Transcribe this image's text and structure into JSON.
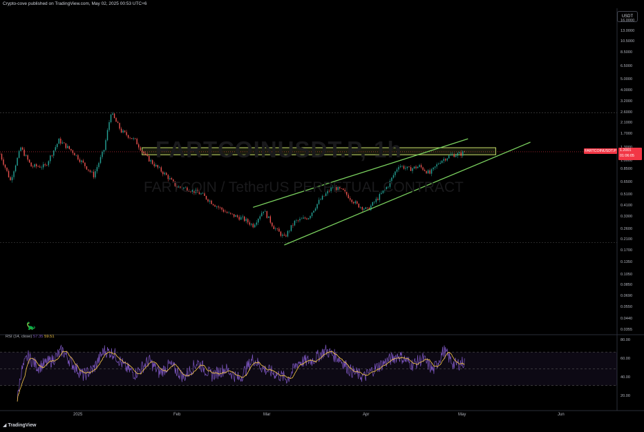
{
  "header": {
    "text": "Crypto-cove published on TradingView.com, May 02, 2025 00:53 UTC+6"
  },
  "watermark": {
    "line1": "FARTCOINUSDT.P, 1h",
    "line2": "FARTCOIN / TetherUS PERPETUAL CONTRACT"
  },
  "currency_button": "USDT",
  "price_axis": {
    "ticks": [
      "16.0000",
      "13.0000",
      "10.5000",
      "8.5000",
      "6.5000",
      "5.0000",
      "4.0000",
      "3.2000",
      "2.6000",
      "2.1000",
      "1.7000",
      "1.3000",
      "1.0000",
      "0.8500",
      "0.6500",
      "0.5100",
      "0.4100",
      "0.3300",
      "0.2600",
      "0.2100",
      "0.1700",
      "0.1350",
      "0.1050",
      "0.0850",
      "0.0690",
      "0.0550",
      "0.0440",
      "0.0355"
    ]
  },
  "last_price": {
    "symbol": "FARTCOINUSDT.P",
    "price": "1.2001",
    "countdown": "01:06:05"
  },
  "rsi": {
    "label": "RSI (14, close)",
    "value": "57.35",
    "ma_value": "59.51",
    "ticks": [
      "80.00",
      "60.00",
      "40.00",
      "20.00"
    ]
  },
  "time_axis": {
    "labels": [
      "2025",
      "Feb",
      "Mar",
      "Apr",
      "May",
      "Jun"
    ]
  },
  "footer": {
    "brand": "TradingView"
  },
  "colors": {
    "up": "#26a69a",
    "down": "#ef5350",
    "trend": "#7bd25f",
    "rsi_line": "#7e57c2",
    "rsi_ma": "#f7c948",
    "zone_border": "#c8e06a",
    "last_price": "#f23645"
  },
  "chart_data": [
    {
      "type": "candlestick",
      "title": "FARTCOINUSDT.P, 1h",
      "y_scale": "log",
      "ylim": [
        0.0355,
        16.0
      ],
      "x_range": [
        "2024-12-18",
        "2025-06-14"
      ],
      "close_path": [
        [
          "2024-12-18",
          1.15
        ],
        [
          "2024-12-21",
          0.68
        ],
        [
          "2024-12-24",
          1.3
        ],
        [
          "2024-12-27",
          0.9
        ],
        [
          "2024-12-31",
          0.9
        ],
        [
          "2025-01-04",
          1.5
        ],
        [
          "2025-01-08",
          1.2
        ],
        [
          "2025-01-11",
          0.95
        ],
        [
          "2025-01-14",
          0.75
        ],
        [
          "2025-01-17",
          1.25
        ],
        [
          "2025-01-19",
          2.6
        ],
        [
          "2025-01-22",
          1.8
        ],
        [
          "2025-01-26",
          1.5
        ],
        [
          "2025-01-29",
          1.1
        ],
        [
          "2025-02-01",
          0.9
        ],
        [
          "2025-02-04",
          0.75
        ],
        [
          "2025-02-07",
          0.6
        ],
        [
          "2025-02-10",
          0.58
        ],
        [
          "2025-02-14",
          0.52
        ],
        [
          "2025-02-18",
          0.42
        ],
        [
          "2025-02-22",
          0.35
        ],
        [
          "2025-02-26",
          0.32
        ],
        [
          "2025-03-01",
          0.28
        ],
        [
          "2025-03-04",
          0.38
        ],
        [
          "2025-03-07",
          0.27
        ],
        [
          "2025-03-10",
          0.22
        ],
        [
          "2025-03-13",
          0.3
        ],
        [
          "2025-03-17",
          0.33
        ],
        [
          "2025-03-20",
          0.45
        ],
        [
          "2025-03-24",
          0.6
        ],
        [
          "2025-03-27",
          0.55
        ],
        [
          "2025-03-31",
          0.42
        ],
        [
          "2025-04-03",
          0.38
        ],
        [
          "2025-04-06",
          0.48
        ],
        [
          "2025-04-09",
          0.62
        ],
        [
          "2025-04-12",
          0.92
        ],
        [
          "2025-04-15",
          0.85
        ],
        [
          "2025-04-18",
          0.9
        ],
        [
          "2025-04-21",
          0.78
        ],
        [
          "2025-04-24",
          1.0
        ],
        [
          "2025-04-27",
          1.12
        ],
        [
          "2025-04-30",
          1.15
        ],
        [
          "2025-05-01",
          1.2
        ]
      ],
      "resistance_zone": {
        "from": "2025-01-28",
        "to": "2025-05-10",
        "low": 1.13,
        "high": 1.3
      },
      "trendlines": [
        {
          "from": [
            "2025-03-01",
            0.4
          ],
          "to": [
            "2025-05-02",
            1.55
          ]
        },
        {
          "from": [
            "2025-03-10",
            0.19
          ],
          "to": [
            "2025-05-20",
            1.45
          ]
        }
      ],
      "horizontal_levels": [
        2.6,
        0.2
      ]
    },
    {
      "type": "line",
      "title": "RSI (14, close)",
      "ylim": [
        10,
        85
      ],
      "bands": [
        70,
        50,
        30
      ],
      "path": [
        [
          "2024-12-23",
          12
        ],
        [
          "2024-12-24",
          45
        ],
        [
          "2024-12-26",
          65
        ],
        [
          "2024-12-29",
          52
        ],
        [
          "2025-01-02",
          60
        ],
        [
          "2025-01-05",
          72
        ],
        [
          "2025-01-08",
          55
        ],
        [
          "2025-01-11",
          42
        ],
        [
          "2025-01-14",
          50
        ],
        [
          "2025-01-17",
          72
        ],
        [
          "2025-01-20",
          68
        ],
        [
          "2025-01-23",
          52
        ],
        [
          "2025-01-26",
          44
        ],
        [
          "2025-01-30",
          60
        ],
        [
          "2025-02-02",
          45
        ],
        [
          "2025-02-05",
          55
        ],
        [
          "2025-02-09",
          40
        ],
        [
          "2025-02-13",
          58
        ],
        [
          "2025-02-17",
          42
        ],
        [
          "2025-02-21",
          50
        ],
        [
          "2025-02-25",
          38
        ],
        [
          "2025-03-01",
          62
        ],
        [
          "2025-03-04",
          50
        ],
        [
          "2025-03-07",
          45
        ],
        [
          "2025-03-11",
          38
        ],
        [
          "2025-03-14",
          58
        ],
        [
          "2025-03-18",
          60
        ],
        [
          "2025-03-22",
          72
        ],
        [
          "2025-03-26",
          62
        ],
        [
          "2025-03-29",
          48
        ],
        [
          "2025-04-02",
          40
        ],
        [
          "2025-04-05",
          50
        ],
        [
          "2025-04-09",
          60
        ],
        [
          "2025-04-12",
          66
        ],
        [
          "2025-04-16",
          55
        ],
        [
          "2025-04-19",
          62
        ],
        [
          "2025-04-22",
          48
        ],
        [
          "2025-04-25",
          72
        ],
        [
          "2025-04-28",
          55
        ],
        [
          "2025-05-01",
          58
        ]
      ]
    }
  ]
}
